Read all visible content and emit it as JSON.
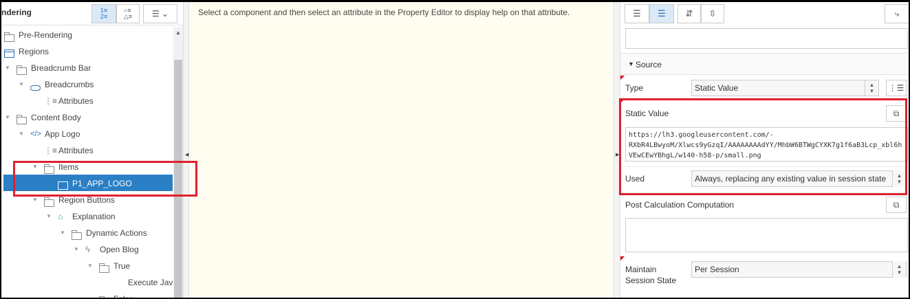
{
  "left": {
    "title": "ndering",
    "toolbar": {
      "btn1": "1≡\n2≡",
      "btn2": "○≡\n△≡",
      "btn3": "☰ ⌄"
    },
    "tree": [
      {
        "label": "Pre-Rendering"
      },
      {
        "label": "Regions"
      },
      {
        "label": "Breadcrumb Bar"
      },
      {
        "label": "Breadcrumbs"
      },
      {
        "label": "Attributes"
      },
      {
        "label": "Content Body"
      },
      {
        "label": "App Logo"
      },
      {
        "label": "Attributes"
      },
      {
        "label": "Items"
      },
      {
        "label": "P1_APP_LOGO"
      },
      {
        "label": "Region Buttons"
      },
      {
        "label": "Explanation"
      },
      {
        "label": "Dynamic Actions"
      },
      {
        "label": "Open Blog"
      },
      {
        "label": "True"
      },
      {
        "label": "Execute Jav"
      },
      {
        "label": "False"
      }
    ]
  },
  "center": {
    "help_text": "Select a component and then select an attribute in the Property Editor to display help on that attribute."
  },
  "right": {
    "section": "Source",
    "type_label": "Type",
    "type_value": "Static Value",
    "static_value_label": "Static Value",
    "static_value_lines": [
      "https://lh3.googleusercontent.com/-",
      "RXbR4LBwyoM/Xlwcs9yGzqI/AAAAAAAAdYY/MhbW6BTWgCYXK7g1f6aB3Lcp_xbl6h",
      "VEwCEwYBhgL/w140-h58-p/small.png"
    ],
    "used_label": "Used",
    "used_value": "Always, replacing any existing value in session state",
    "post_calc_label": "Post Calculation Computation",
    "maintain_label_1": "Maintain",
    "maintain_label_2": "Session State",
    "maintain_value": "Per Session"
  }
}
